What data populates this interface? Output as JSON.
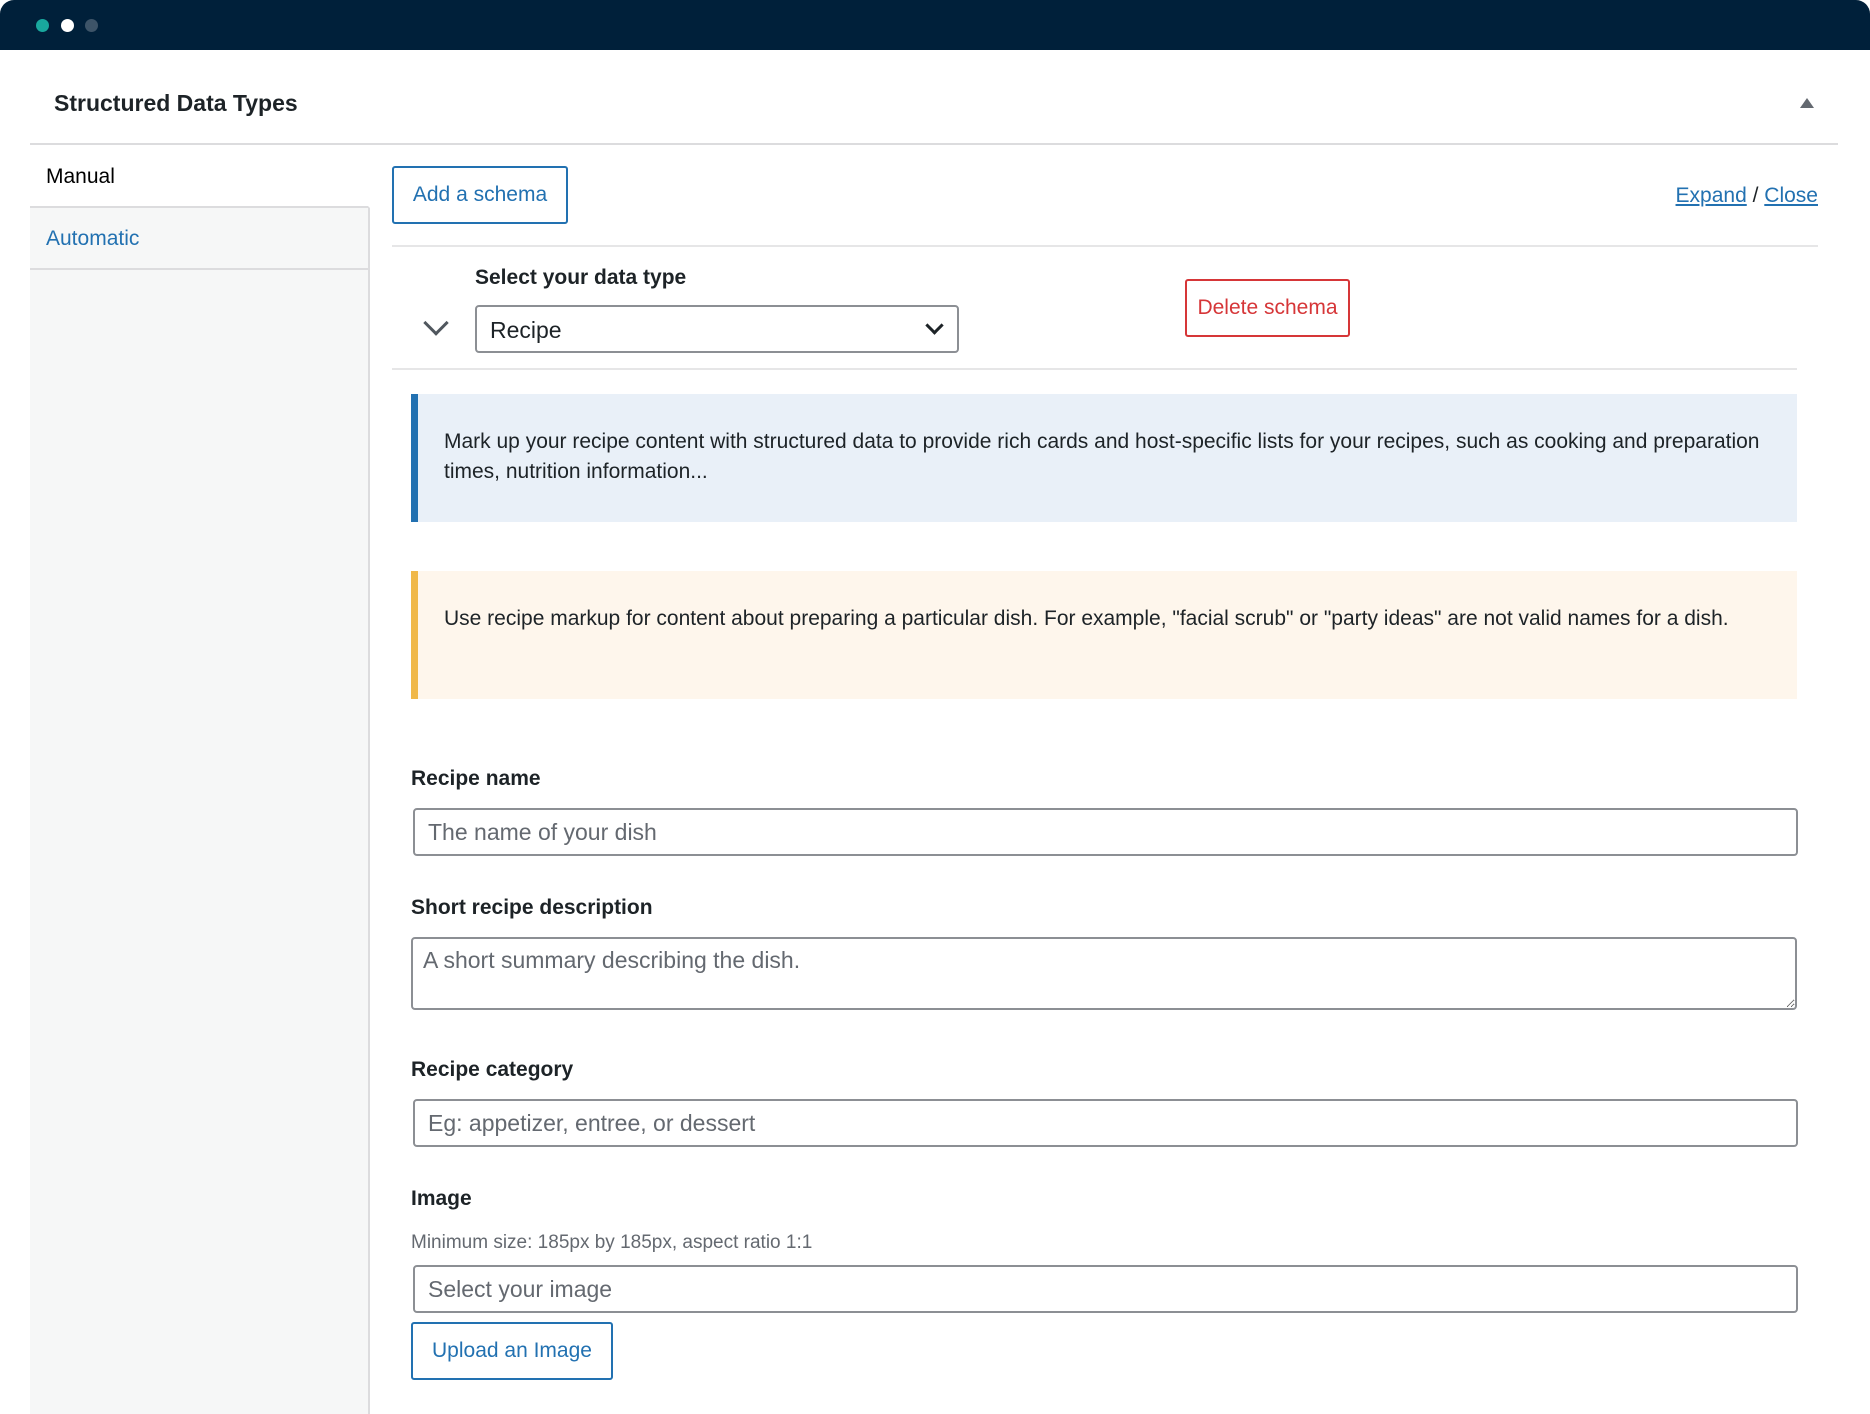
{
  "panel": {
    "title": "Structured Data Types"
  },
  "sidebar": {
    "items": [
      {
        "label": "Manual",
        "active": true
      },
      {
        "label": "Automatic",
        "active": false
      }
    ]
  },
  "toolbar": {
    "add_schema_label": "Add a schema",
    "expand_label": "Expand",
    "separator": "/",
    "close_label": "Close"
  },
  "schema": {
    "data_type_label": "Select your data type",
    "data_type_value": "Recipe",
    "delete_label": "Delete schema"
  },
  "notices": {
    "info": "Mark up your recipe content with structured data to provide rich cards and host-specific lists for your recipes, such as cooking and preparation times, nutrition information...",
    "warning": "Use recipe markup for content about preparing a particular dish. For example, \"facial scrub\" or \"party ideas\" are not valid names for a dish."
  },
  "fields": {
    "recipe_name": {
      "label": "Recipe name",
      "placeholder": "The name of your dish"
    },
    "description": {
      "label": "Short recipe description",
      "placeholder": "A short summary describing the dish."
    },
    "category": {
      "label": "Recipe category",
      "placeholder": "Eg: appetizer, entree, or dessert"
    },
    "image": {
      "label": "Image",
      "hint": "Minimum size: 185px by 185px, aspect ratio 1:1",
      "placeholder": "Select your image",
      "upload_label": "Upload an Image"
    }
  },
  "colors": {
    "titlebar": "#00203a",
    "accent": "#2271b1",
    "danger": "#d63638",
    "warning": "#f0b849"
  }
}
